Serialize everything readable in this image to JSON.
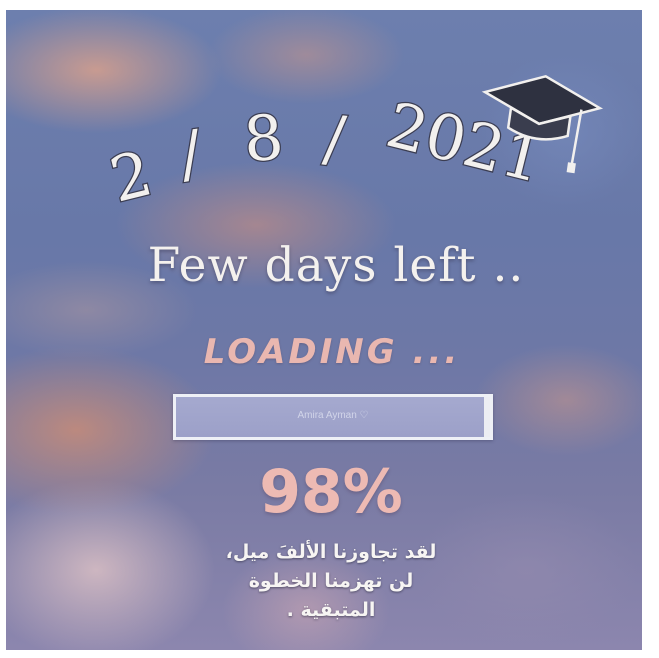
{
  "date": {
    "day": "2",
    "sep1": "/",
    "month": "8",
    "sep2": "/",
    "year": "2021"
  },
  "icons": {
    "cap": "graduation-cap-icon"
  },
  "subtitle": "Few days left ..",
  "loading_label": "LOADING ...",
  "progress": {
    "fraction": 0.98,
    "bar_text": "Amira Ayman ♡"
  },
  "percent_label": "98%",
  "message": {
    "line1": "لقد تجاوزنا الألفَ ميل،",
    "line2": "لن تهزمنا الخطوة",
    "line3": "المتبقية ."
  },
  "colors": {
    "accent_pink": "#edbab3",
    "text_white": "#f4f1ee",
    "bar_fill": "#9ca0c8"
  }
}
